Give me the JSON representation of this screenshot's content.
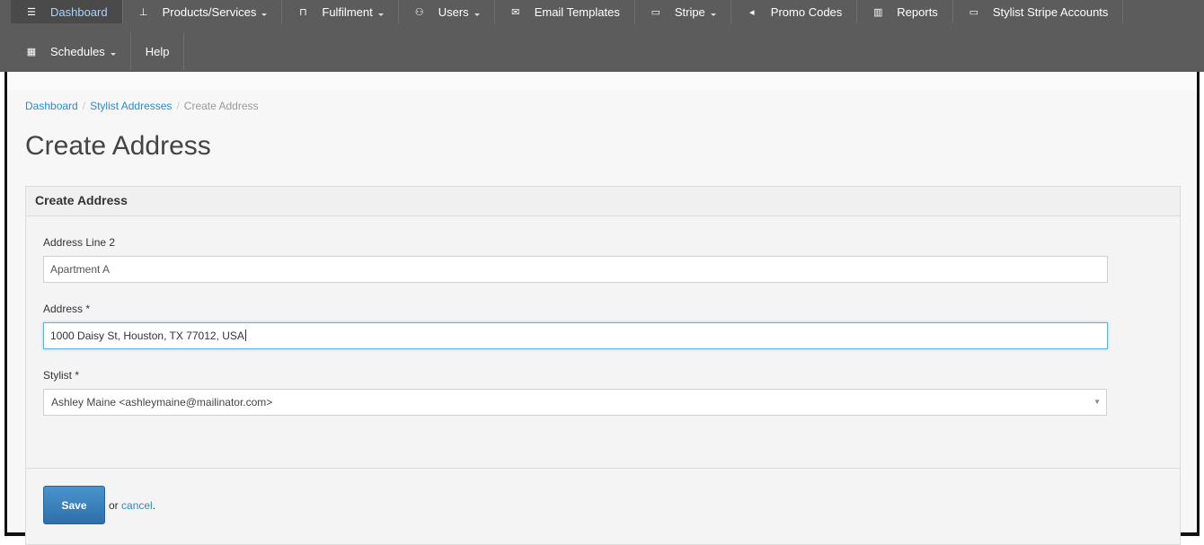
{
  "nav": {
    "row1": [
      {
        "label": "Dashboard",
        "icon": "list-icon",
        "caret": false,
        "active": true
      },
      {
        "label": "Products/Services",
        "icon": "sitemap-icon",
        "caret": true
      },
      {
        "label": "Fulfilment",
        "icon": "cart-icon",
        "caret": true
      },
      {
        "label": "Users",
        "icon": "users-icon",
        "caret": true
      },
      {
        "label": "Email Templates",
        "icon": "envelope-icon",
        "caret": false
      },
      {
        "label": "Stripe",
        "icon": "credit-card-icon",
        "caret": true
      },
      {
        "label": "Promo Codes",
        "icon": "bullhorn-icon",
        "caret": false
      },
      {
        "label": "Reports",
        "icon": "bar-chart-icon",
        "caret": false
      },
      {
        "label": "Stylist Stripe Accounts",
        "icon": "credit-card-icon",
        "caret": false
      }
    ],
    "row2": [
      {
        "label": "Schedules",
        "icon": "calendar-icon",
        "caret": true
      },
      {
        "label": "Help",
        "icon": "",
        "caret": false
      }
    ]
  },
  "breadcrumb": {
    "home": "Dashboard",
    "parent": "Stylist Addresses",
    "current": "Create Address",
    "separator": "/"
  },
  "page": {
    "title": "Create Address"
  },
  "panel": {
    "heading": "Create Address",
    "fields": {
      "address_line_2": {
        "label": "Address Line 2",
        "value": "Apartment A"
      },
      "address": {
        "label": "Address *",
        "value": "1000 Daisy St, Houston, TX 77012, USA"
      },
      "stylist": {
        "label": "Stylist *",
        "value": "Ashley Maine <ashleymaine@mailinator.com>"
      }
    },
    "actions": {
      "save": "Save",
      "or": "or",
      "cancel": "cancel",
      "period": "."
    }
  },
  "colors": {
    "navbar": "#5c5c5c",
    "link": "#2a8cc7",
    "primary_button": "#3a7fbd"
  }
}
